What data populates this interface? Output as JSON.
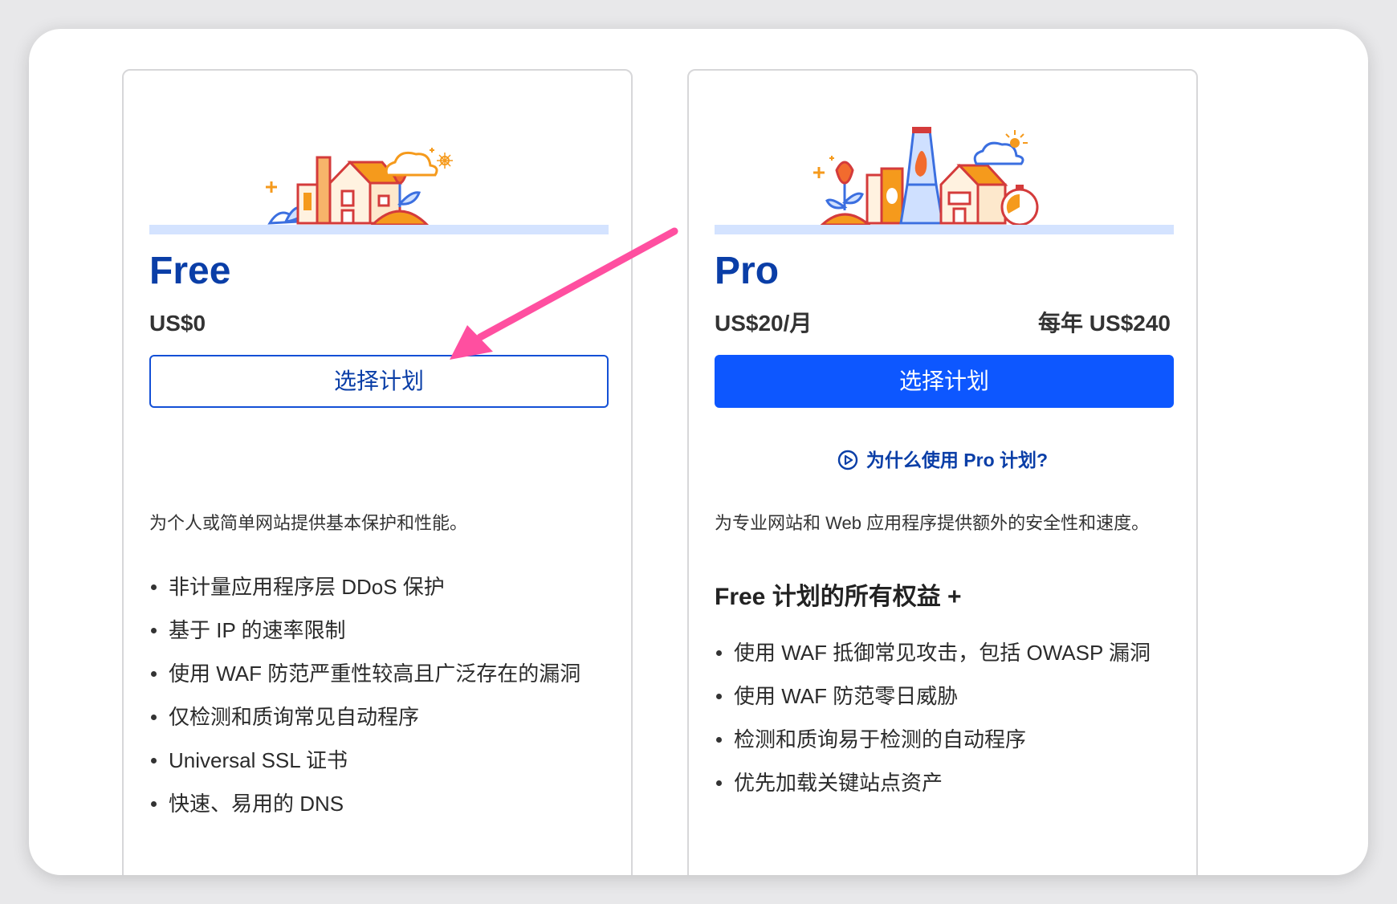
{
  "free": {
    "name": "Free",
    "price": "US$0",
    "cta_label": "选择计划",
    "description": "为个人或简单网站提供基本保护和性能。",
    "features": [
      "非计量应用程序层 DDoS 保护",
      "基于 IP 的速率限制",
      "使用 WAF 防范严重性较高且广泛存在的漏洞",
      "仅检测和质询常见自动程序",
      "Universal SSL 证书",
      "快速、易用的 DNS"
    ]
  },
  "pro": {
    "name": "Pro",
    "price": "US$20/月",
    "annual_price": "每年 US$240",
    "cta_label": "选择计划",
    "why_link": "为什么使用 Pro 计划?",
    "description": "为专业网站和 Web 应用程序提供额外的安全性和速度。",
    "subheading": "Free 计划的所有权益 +",
    "features": [
      "使用 WAF 抵御常见攻击，包括 OWASP 漏洞",
      "使用 WAF 防范零日威胁",
      "检测和质询易于检测的自动程序",
      "优先加载关键站点资产"
    ]
  },
  "colors": {
    "brand_blue": "#0a3ea7",
    "cta_blue": "#0d57ff",
    "annotation_pink": "#ff4fa0",
    "band_blue": "#d4e3ff"
  }
}
